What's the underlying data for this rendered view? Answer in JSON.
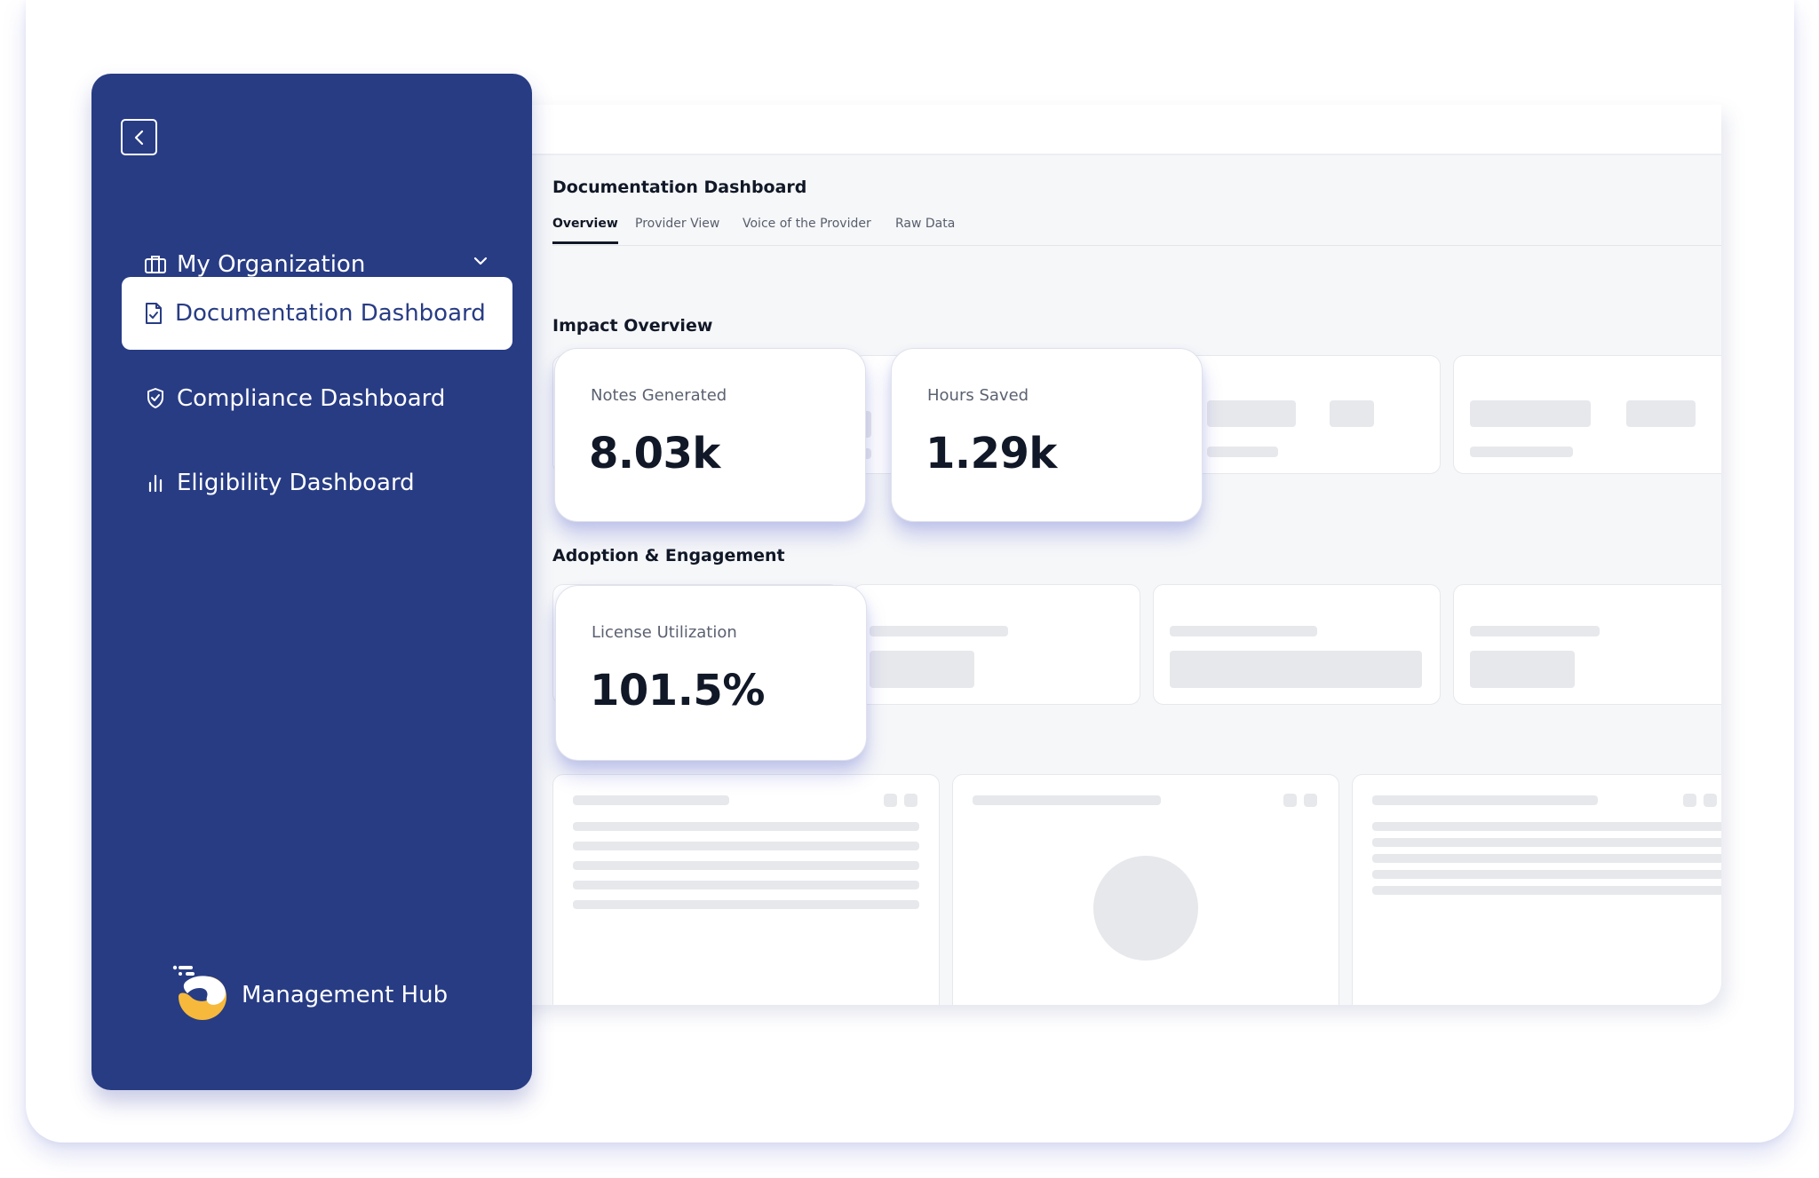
{
  "window": {
    "title": "Documentation Dashboard",
    "tabs": [
      {
        "label": "Overview",
        "active": true
      },
      {
        "label": "Provider View",
        "active": false
      },
      {
        "label": "Voice of the Provider",
        "active": false
      },
      {
        "label": "Raw Data",
        "active": false
      }
    ]
  },
  "sections": {
    "impact_title": "Impact Overview",
    "adoption_title": "Adoption & Engagement"
  },
  "metrics": {
    "notes": {
      "label": "Notes Generated",
      "value": "8.03k"
    },
    "hours": {
      "label": "Hours Saved",
      "value": "1.29k"
    },
    "license": {
      "label": "License Utilization",
      "value": "101.5%"
    }
  },
  "sidebar": {
    "items": [
      {
        "label": "My Organization",
        "icon": "briefcase-icon",
        "expandable": true
      },
      {
        "label": "Documentation Dashboard",
        "icon": "document-check-icon",
        "active": true
      },
      {
        "label": "Compliance Dashboard",
        "icon": "shield-check-icon"
      },
      {
        "label": "Eligibility Dashboard",
        "icon": "bar-chart-icon"
      }
    ],
    "brand": "Management Hub"
  },
  "colors": {
    "sidebar": "#283c84",
    "accent_yellow": "#f6b93b",
    "text_dark": "#111827",
    "skeleton": "#e7e8ec"
  }
}
